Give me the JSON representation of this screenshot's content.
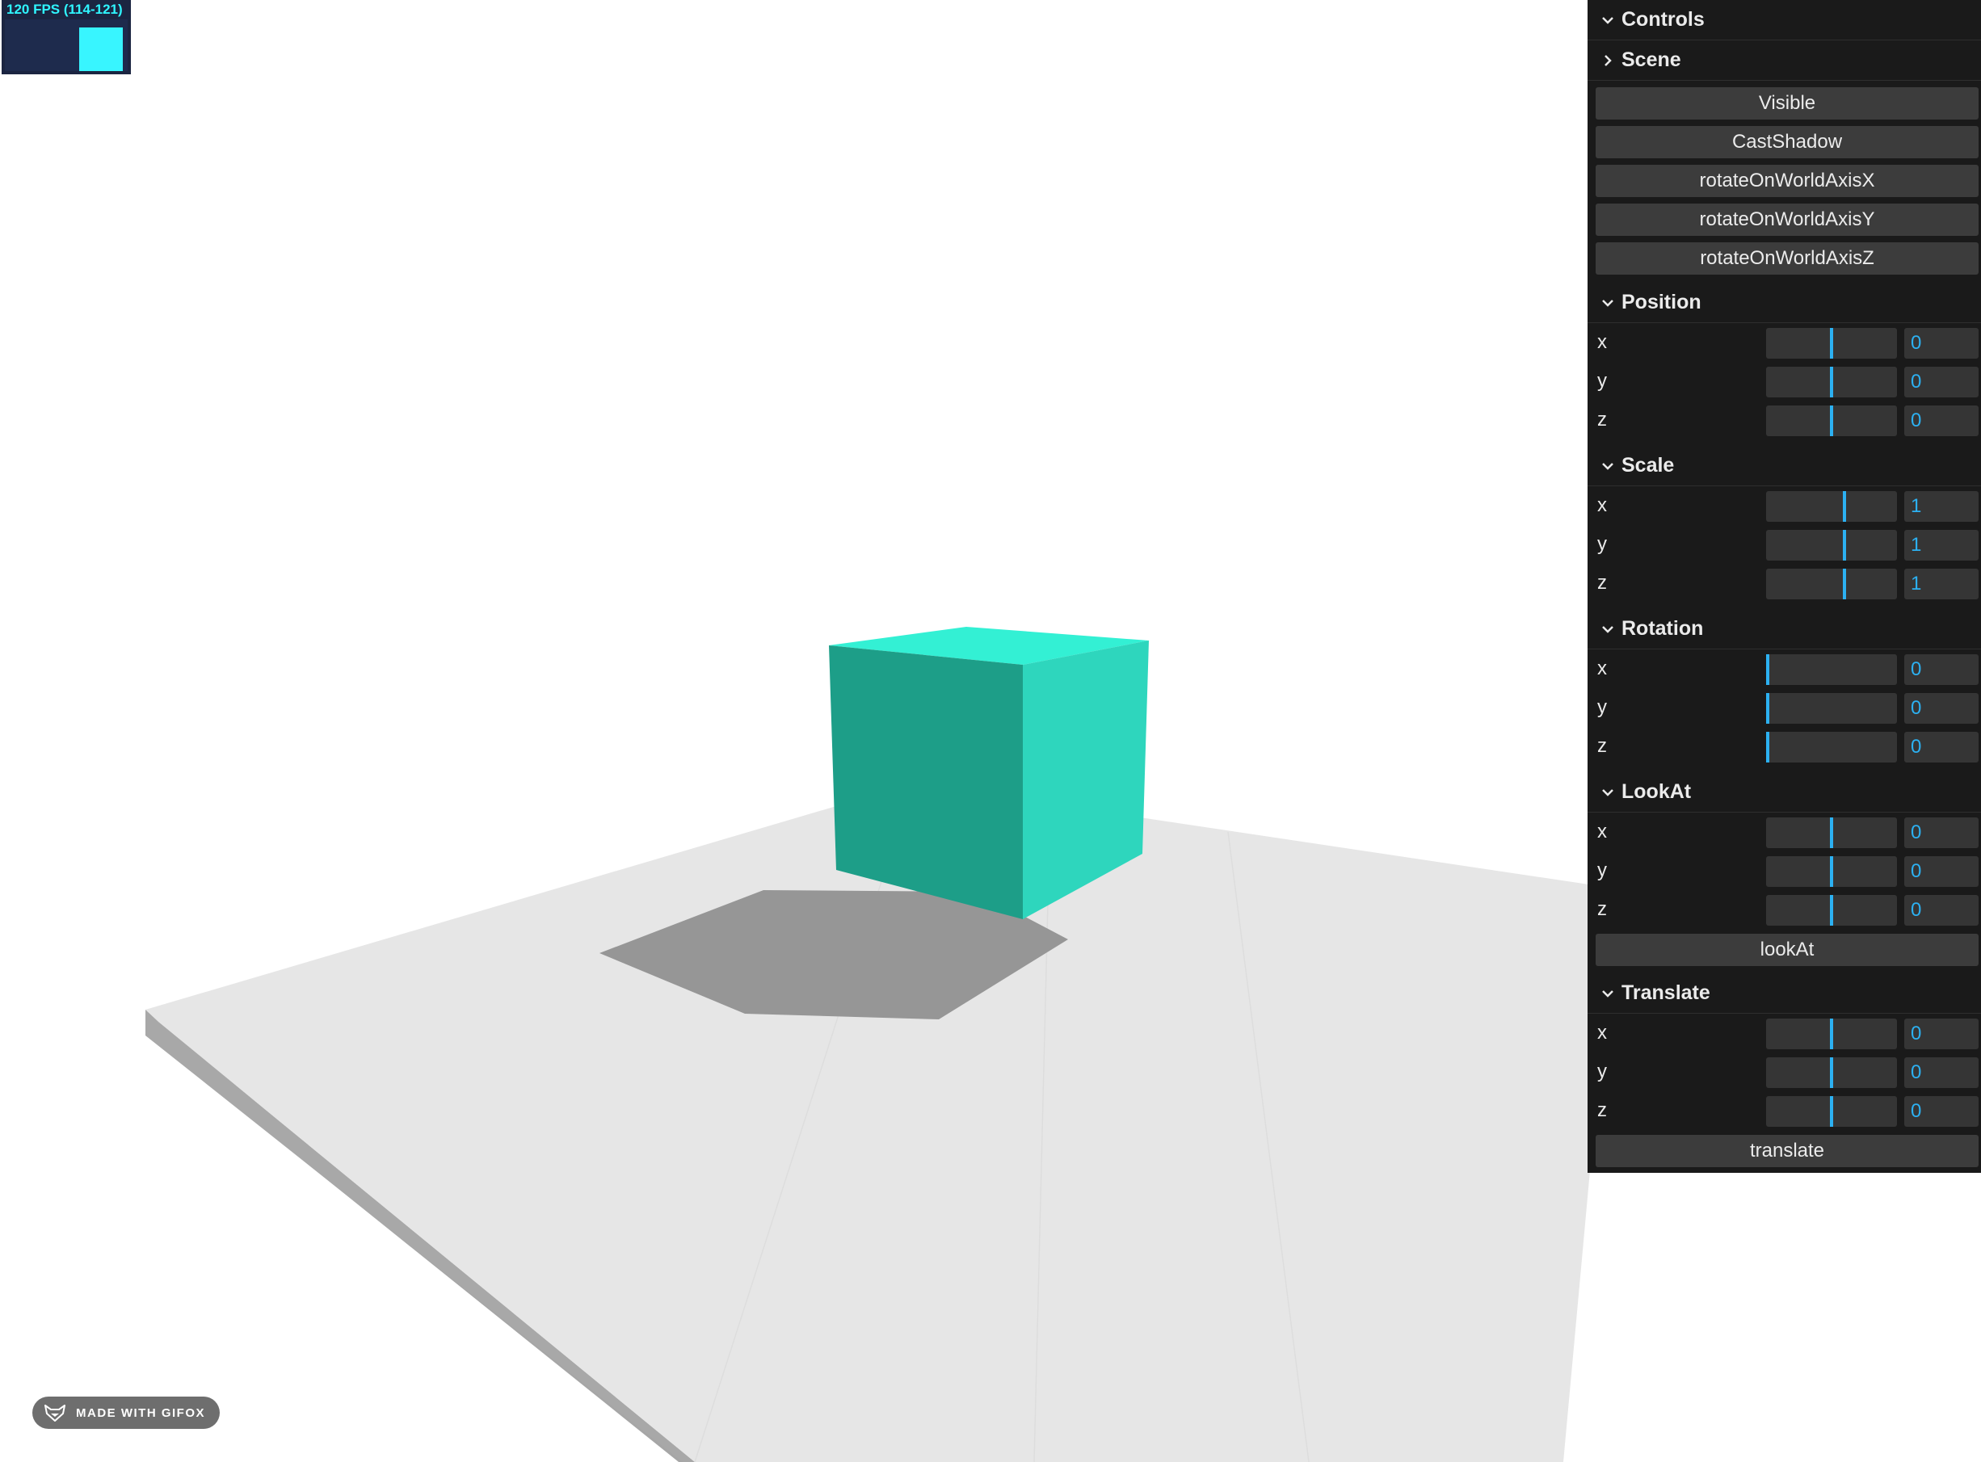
{
  "stats": {
    "fps_label": "120 FPS (114-121)",
    "fill_fraction": 0.85,
    "color": "#38f5ff"
  },
  "badge": {
    "text": "MADE WITH GIFOX",
    "icon": "fox-icon"
  },
  "scene": {
    "cube_colors": {
      "top": "#33f0d4",
      "front": "#1d9e88",
      "side": "#2ed6bd"
    },
    "ground_color": "#e6e6e6",
    "ground_edge_color": "#a6a6a6",
    "shadow_color": "#969696"
  },
  "panel": {
    "title": "Controls",
    "scene_folder": "Scene",
    "buttons": [
      "Visible",
      "CastShadow",
      "rotateOnWorldAxisX",
      "rotateOnWorldAxisY",
      "rotateOnWorldAxisZ"
    ],
    "position": {
      "title": "Position",
      "x": {
        "label": "x",
        "value": "0",
        "fraction": 0.5
      },
      "y": {
        "label": "y",
        "value": "0",
        "fraction": 0.5
      },
      "z": {
        "label": "z",
        "value": "0",
        "fraction": 0.5
      }
    },
    "scale": {
      "title": "Scale",
      "x": {
        "label": "x",
        "value": "1",
        "fraction": 0.6
      },
      "y": {
        "label": "y",
        "value": "1",
        "fraction": 0.6
      },
      "z": {
        "label": "z",
        "value": "1",
        "fraction": 0.6
      }
    },
    "rotation": {
      "title": "Rotation",
      "x": {
        "label": "x",
        "value": "0",
        "fraction": 0
      },
      "y": {
        "label": "y",
        "value": "0",
        "fraction": 0
      },
      "z": {
        "label": "z",
        "value": "0",
        "fraction": 0
      }
    },
    "lookat": {
      "title": "LookAt",
      "x": {
        "label": "x",
        "value": "0",
        "fraction": 0.5
      },
      "y": {
        "label": "y",
        "value": "0",
        "fraction": 0.5
      },
      "z": {
        "label": "z",
        "value": "0",
        "fraction": 0.5
      },
      "button": "lookAt"
    },
    "translate": {
      "title": "Translate",
      "x": {
        "label": "x",
        "value": "0",
        "fraction": 0.5
      },
      "y": {
        "label": "y",
        "value": "0",
        "fraction": 0.5
      },
      "z": {
        "label": "z",
        "value": "0",
        "fraction": 0.5
      },
      "button": "translate"
    },
    "accent_color": "#2cb1f2"
  }
}
